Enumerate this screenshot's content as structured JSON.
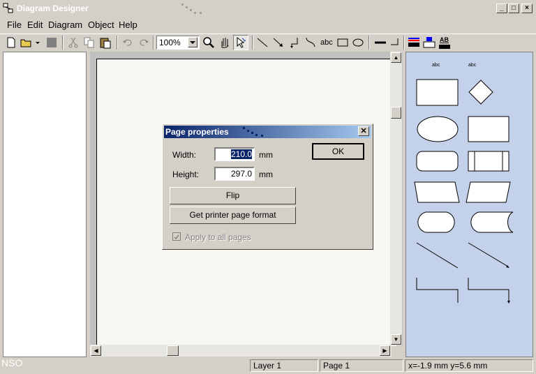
{
  "app": {
    "title": "Diagram Designer"
  },
  "menu": [
    "File",
    "Edit",
    "Diagram",
    "Object",
    "Help"
  ],
  "toolbar": {
    "zoom_value": "100%",
    "text_tool_label": "abc",
    "color_ab_label": "AB"
  },
  "shapes_panel": {
    "text_labels": [
      "abc",
      "abc"
    ]
  },
  "dialog": {
    "title": "Page properties",
    "width_label": "Width:",
    "width_value": "210.0",
    "height_label": "Height:",
    "height_value": "297.0",
    "unit": "mm",
    "ok_label": "OK",
    "flip_label": "Flip",
    "printer_label": "Get printer page format",
    "apply_all_label": "Apply to all pages"
  },
  "status": {
    "left_text": "NSO",
    "layer": "Layer 1",
    "page": "Page 1",
    "coords": "x=-1.9 mm  y=5.6 mm"
  },
  "colors": {
    "title_gradient_start": "#0a246a",
    "shapes_panel_bg": "#c3d2ea"
  }
}
